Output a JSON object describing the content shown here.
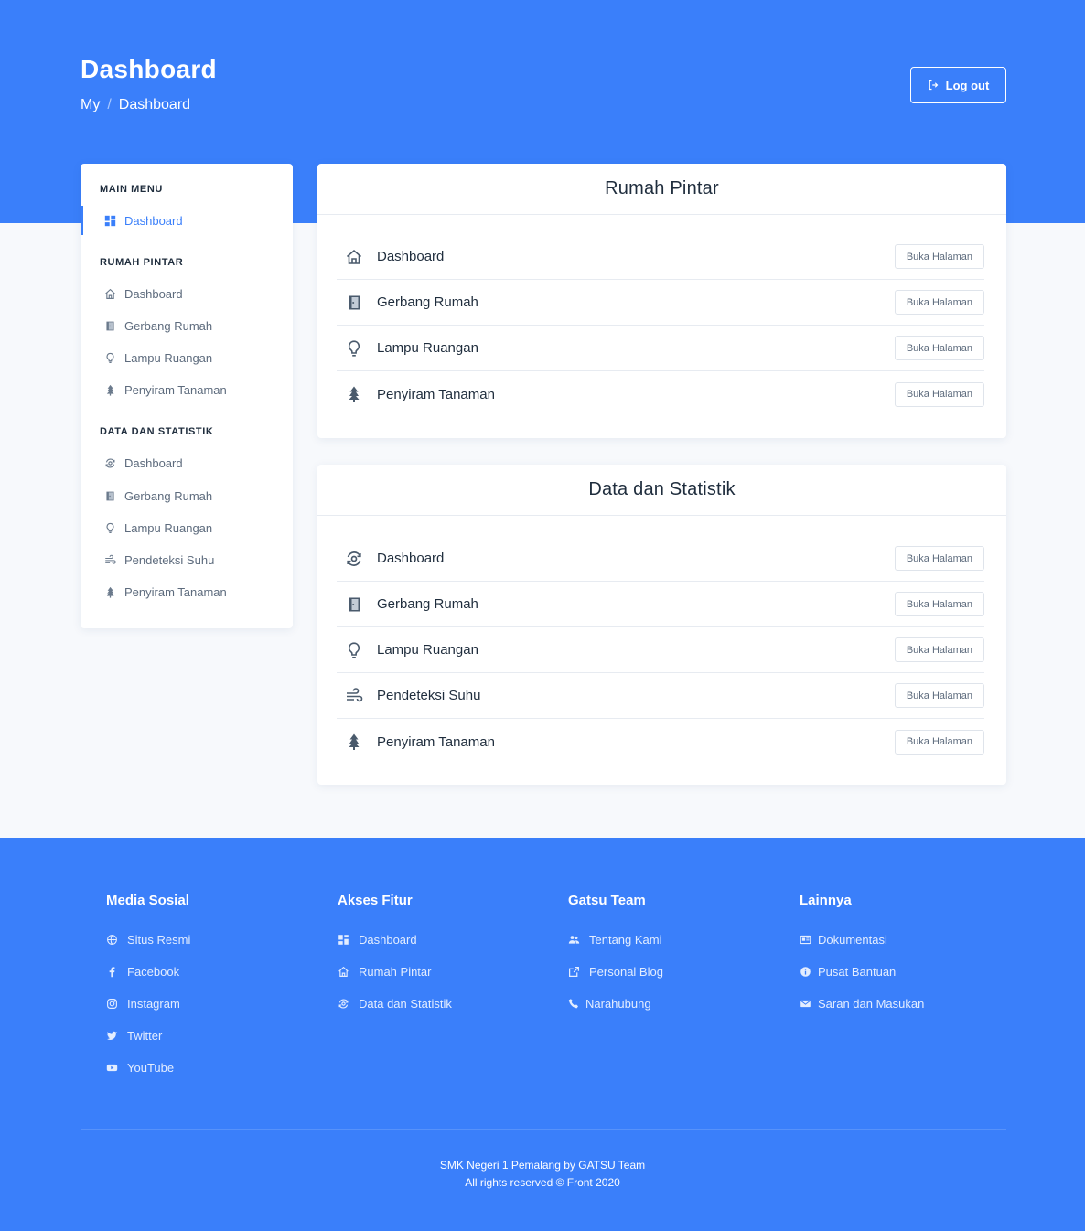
{
  "header": {
    "title": "Dashboard",
    "breadcrumb": [
      "My",
      "Dashboard"
    ],
    "breadcrumb_sep": "/",
    "logout_label": "Log out"
  },
  "sidebar": {
    "sections": [
      {
        "heading": "MAIN MENU",
        "items": [
          {
            "label": "Dashboard",
            "icon": "grid-icon",
            "active": true
          }
        ]
      },
      {
        "heading": "RUMAH PINTAR",
        "items": [
          {
            "label": "Dashboard",
            "icon": "home-icon"
          },
          {
            "label": "Gerbang Rumah",
            "icon": "door-icon"
          },
          {
            "label": "Lampu Ruangan",
            "icon": "bulb-icon"
          },
          {
            "label": "Penyiram Tanaman",
            "icon": "tree-icon"
          }
        ]
      },
      {
        "heading": "DATA DAN STATISTIK",
        "items": [
          {
            "label": "Dashboard",
            "icon": "gauge-icon"
          },
          {
            "label": "Gerbang Rumah",
            "icon": "door-icon"
          },
          {
            "label": "Lampu Ruangan",
            "icon": "bulb-icon"
          },
          {
            "label": "Pendeteksi Suhu",
            "icon": "wind-icon"
          },
          {
            "label": "Penyiram Tanaman",
            "icon": "tree-icon"
          }
        ]
      }
    ]
  },
  "cards": [
    {
      "title": "Rumah Pintar",
      "rows": [
        {
          "label": "Dashboard",
          "icon": "home-icon",
          "button": "Buka Halaman"
        },
        {
          "label": "Gerbang Rumah",
          "icon": "door-icon",
          "button": "Buka Halaman"
        },
        {
          "label": "Lampu Ruangan",
          "icon": "bulb-icon",
          "button": "Buka Halaman"
        },
        {
          "label": "Penyiram Tanaman",
          "icon": "tree-icon",
          "button": "Buka Halaman"
        }
      ]
    },
    {
      "title": "Data dan Statistik",
      "rows": [
        {
          "label": "Dashboard",
          "icon": "gauge-icon",
          "button": "Buka Halaman"
        },
        {
          "label": "Gerbang Rumah",
          "icon": "door-icon",
          "button": "Buka Halaman"
        },
        {
          "label": "Lampu Ruangan",
          "icon": "bulb-icon",
          "button": "Buka Halaman"
        },
        {
          "label": "Pendeteksi Suhu",
          "icon": "wind-icon",
          "button": "Buka Halaman"
        },
        {
          "label": "Penyiram Tanaman",
          "icon": "tree-icon",
          "button": "Buka Halaman"
        }
      ]
    }
  ],
  "footer": {
    "columns": [
      {
        "heading": "Media Sosial",
        "links": [
          {
            "label": "Situs Resmi",
            "icon": "globe-icon"
          },
          {
            "label": "Facebook",
            "icon": "facebook-icon"
          },
          {
            "label": "Instagram",
            "icon": "instagram-icon"
          },
          {
            "label": "Twitter",
            "icon": "twitter-icon"
          },
          {
            "label": "YouTube",
            "icon": "youtube-icon"
          }
        ]
      },
      {
        "heading": "Akses Fitur",
        "links": [
          {
            "label": "Dashboard",
            "icon": "grid-icon"
          },
          {
            "label": "Rumah Pintar",
            "icon": "home-icon"
          },
          {
            "label": "Data dan Statistik",
            "icon": "gauge-icon"
          }
        ]
      },
      {
        "heading": "Gatsu Team",
        "links": [
          {
            "label": "Tentang Kami",
            "icon": "users-icon"
          },
          {
            "label": "Personal Blog",
            "icon": "external-link-icon"
          },
          {
            "label": "Narahubung",
            "icon": "phone-icon"
          }
        ]
      },
      {
        "heading": "Lainnya",
        "links": [
          {
            "label": "Dokumentasi",
            "icon": "id-card-icon"
          },
          {
            "label": "Pusat Bantuan",
            "icon": "info-icon"
          },
          {
            "label": "Saran dan Masukan",
            "icon": "mail-icon"
          }
        ]
      }
    ],
    "copyright_line1": "SMK Negeri 1 Pemalang by GATSU Team",
    "copyright_line2": "All rights reserved © Front 2020"
  },
  "colors": {
    "primary": "#3a7ffa",
    "background": "#f7f9fc",
    "text": "#1f2d3d",
    "muted": "#5d6b7d"
  }
}
